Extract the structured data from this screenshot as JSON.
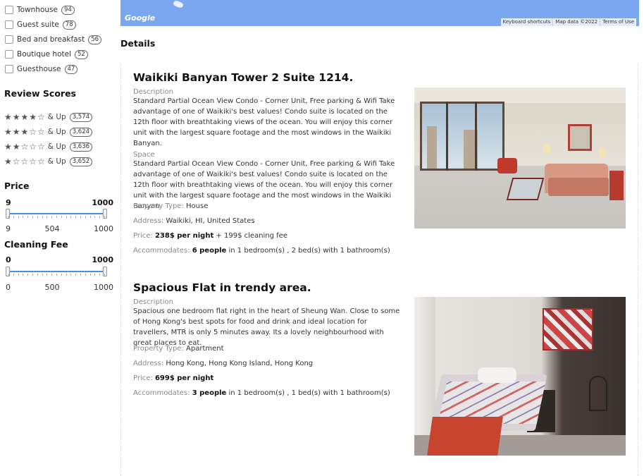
{
  "sidebar": {
    "property_types": [
      {
        "label": "Townhouse",
        "count": "94"
      },
      {
        "label": "Guest suite",
        "count": "78"
      },
      {
        "label": "Bed and breakfast",
        "count": "56"
      },
      {
        "label": "Boutique hotel",
        "count": "52"
      },
      {
        "label": "Guesthouse",
        "count": "47"
      }
    ],
    "review_scores": {
      "title": "Review Scores",
      "rows": [
        {
          "stars": "★★★★☆",
          "suffix": "& Up",
          "count": "3,574"
        },
        {
          "stars": "★★★☆☆",
          "suffix": "& Up",
          "count": "3,624"
        },
        {
          "stars": "★★☆☆☆",
          "suffix": "& Up",
          "count": "3,636"
        },
        {
          "stars": "★☆☆☆☆",
          "suffix": "& Up",
          "count": "3,652"
        }
      ]
    },
    "price": {
      "title": "Price",
      "min": "9",
      "max": "1000",
      "scale": [
        "9",
        "504",
        "1000"
      ]
    },
    "cleaning_fee": {
      "title": "Cleaning Fee",
      "min": "0",
      "max": "1000",
      "scale": [
        "0",
        "500",
        "1000"
      ]
    }
  },
  "map": {
    "logo": "Google",
    "attribution": [
      "Keyboard shortcuts",
      "Map data ©2022",
      "Terms of Use"
    ]
  },
  "details_title": "Details",
  "listings": [
    {
      "title": "Waikiki Banyan Tower 2 Suite 1214.",
      "description_label": "Description",
      "description": "Standard Partial Ocean View Condo - Corner Unit, Free parking & Wifi Take advantage of one of Waikiki's best values! Condo suite is located on the 12th floor with breathtaking views of the ocean. You will enjoy this corner unit with the largest square footage and the most windows in the Waikiki Banyan.",
      "space_label": "Space",
      "space": "Standard Partial Ocean View Condo - Corner Unit, Free parking & Wifi Take advantage of one of Waikiki's best values! Condo suite is located on the 12th floor with breathtaking views of the ocean. You will enjoy this corner unit with the largest square footage and the most windows in the Waikiki Banyan.",
      "property_type_label": "Property Type:",
      "property_type": "House",
      "address_label": "Address:",
      "address": "Waikiki, HI, United States",
      "price_label": "Price:",
      "price": "238$ per night",
      "price_extra": "+ 199$ cleaning fee",
      "accommodates_label": "Accommodates:",
      "accommodates": "6 people",
      "rooms": "in 1 bedroom(s) , 2 bed(s) with 1 bathroom(s)"
    },
    {
      "title": "Spacious Flat in trendy area.",
      "description_label": "Description",
      "description": "Spacious one bedroom flat right in the heart of Sheung Wan. Close to some of Hong Kong's best spots for food and drink and ideal location for travellers, MTR is only 5 minutes away. Its a lovely neighbourhood with great places to eat.",
      "property_type_label": "Property Type:",
      "property_type": "Apartment",
      "address_label": "Address:",
      "address": "Hong Kong, Hong Kong Island, Hong Kong",
      "price_label": "Price:",
      "price": "699$ per night",
      "accommodates_label": "Accommodates:",
      "accommodates": "3 people",
      "rooms": "in 1 bedroom(s) , 1 bed(s) with 1 bathroom(s)"
    }
  ],
  "colors": {
    "slider": "#4a90e2",
    "map": "#7aa7f0"
  }
}
